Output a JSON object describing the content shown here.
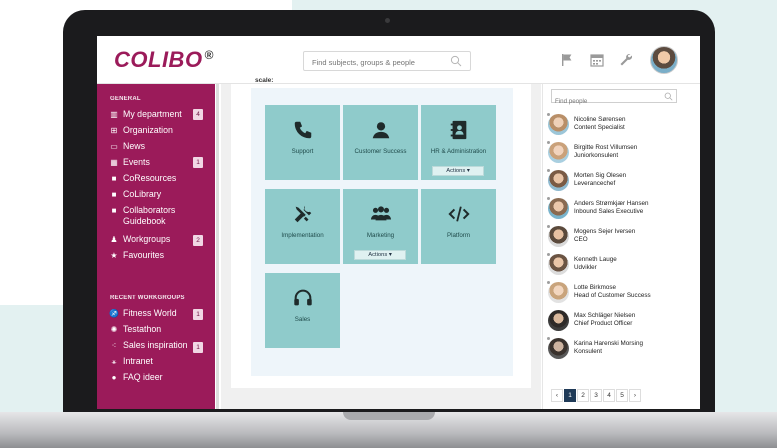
{
  "app": {
    "logo": "COLIBO",
    "logo_mark": "®",
    "search_placeholder": "Find subjects, groups & people"
  },
  "sidebar": {
    "section_general": "GENERAL",
    "section_recent": "RECENT WORKGROUPS",
    "general_items": [
      {
        "label": "My department",
        "icon": "department-icon",
        "badge": "4"
      },
      {
        "label": "Organization",
        "icon": "organization-icon",
        "badge": ""
      },
      {
        "label": "News",
        "icon": "news-icon",
        "badge": ""
      },
      {
        "label": "Events",
        "icon": "calendar-icon",
        "badge": "1"
      },
      {
        "label": "CoResources",
        "icon": "book-icon",
        "badge": ""
      },
      {
        "label": "CoLibrary",
        "icon": "book-icon",
        "badge": ""
      },
      {
        "label": "Collaborators Guidebook",
        "icon": "book-icon",
        "badge": ""
      },
      {
        "label": "Workgroups",
        "icon": "group-icon",
        "badge": "2"
      },
      {
        "label": "Favourites",
        "icon": "star-icon",
        "badge": ""
      }
    ],
    "recent_items": [
      {
        "label": "Fitness World",
        "icon": "workgroup-icon",
        "badge": "1"
      },
      {
        "label": "Testathon",
        "icon": "bug-icon",
        "badge": ""
      },
      {
        "label": "Sales inspiration",
        "icon": "dots-icon",
        "badge": "1"
      },
      {
        "label": "Intranet",
        "icon": "network-icon",
        "badge": ""
      },
      {
        "label": "FAQ ideer",
        "icon": "pin-icon",
        "badge": ""
      }
    ]
  },
  "main": {
    "scale_label": "scale:",
    "tiles": [
      {
        "label": "Support",
        "icon": "phone-icon",
        "action": ""
      },
      {
        "label": "Customer Success",
        "icon": "person-icon",
        "action": ""
      },
      {
        "label": "HR & Administration",
        "icon": "address-book-icon",
        "action": "Actions ▾"
      },
      {
        "label": "Implementation",
        "icon": "tools-icon",
        "action": ""
      },
      {
        "label": "Marketing",
        "icon": "people-icon",
        "action": "Actions ▾"
      },
      {
        "label": "Platform",
        "icon": "code-icon",
        "action": ""
      },
      {
        "label": "Sales",
        "icon": "headset-icon",
        "action": ""
      }
    ]
  },
  "people": {
    "find_placeholder": "Find people",
    "list": [
      {
        "name": "Nicoline Sørensen",
        "role": "Content Specialist"
      },
      {
        "name": "Birgitte Rost Villumsen",
        "role": "Juniorkonsulent"
      },
      {
        "name": "Morten Sig Olesen",
        "role": "Leverancechef"
      },
      {
        "name": "Anders Strømkjær Hansen",
        "role": "Inbound Sales Executive"
      },
      {
        "name": "Mogens Sejer Iversen",
        "role": "CEO"
      },
      {
        "name": "Kenneth Lauge",
        "role": "Udvikler"
      },
      {
        "name": "Lotte Birkmose",
        "role": "Head of Customer Success"
      },
      {
        "name": "Max Schläger Nielsen",
        "role": "Chief Product Officer"
      },
      {
        "name": "Karina Harenski Morsing",
        "role": "Konsulent"
      }
    ],
    "pagination": {
      "prev": "‹",
      "pages": [
        "1",
        "2",
        "3",
        "4",
        "5"
      ],
      "next": "›",
      "current": "1"
    }
  },
  "colors": {
    "brand": "#9b1b5a",
    "tile": "#8fcbcb",
    "page_bg": "#e3f1f1",
    "pager_active": "#1f3a57"
  }
}
